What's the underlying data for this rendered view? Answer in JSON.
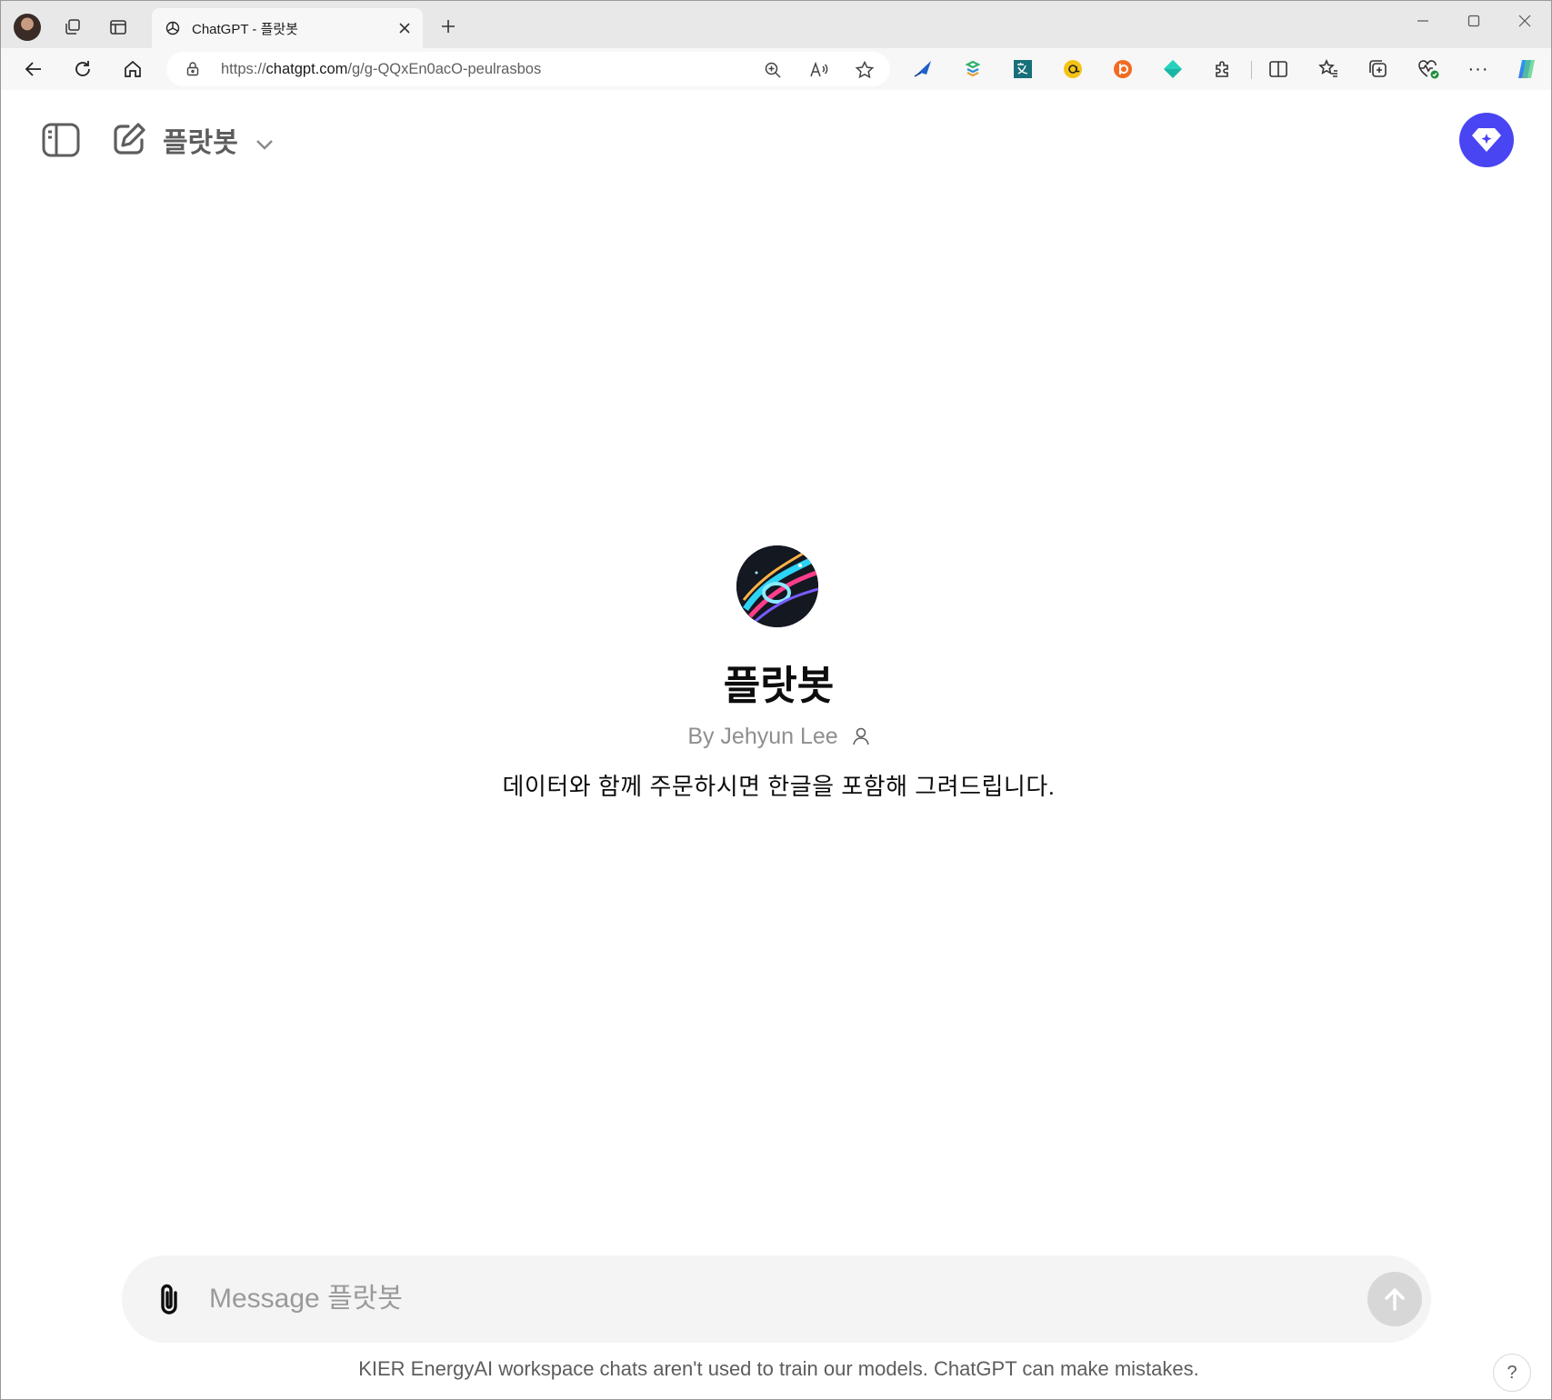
{
  "browser": {
    "tab": {
      "title": "ChatGPT - 플랏봇",
      "close_glyph": "✕"
    },
    "new_tab_glyph": "+",
    "address": {
      "scheme": "https://",
      "host": "chatgpt.com",
      "path": "/g/g-QQxEn0acO-peulrasbos"
    },
    "window_controls": {
      "minimize": "—",
      "maximize": "☐",
      "close": "✕"
    },
    "more_glyph": "···"
  },
  "header": {
    "model_title": "플랏봇"
  },
  "gpt": {
    "name": "플랏봇",
    "author": "By Jehyun Lee",
    "description": "데이터와 함께 주문하시면 한글을 포함해 그려드립니다."
  },
  "composer": {
    "placeholder": "Message 플랏봇",
    "value": ""
  },
  "footer": {
    "disclaimer": "KIER EnergyAI workspace chats aren't used to train our models. ChatGPT can make mistakes.",
    "help_label": "?"
  },
  "colors": {
    "accent": "#4a45f2",
    "composer_bg": "#f4f4f4",
    "send_disabled": "#d7d7d7"
  },
  "icons": [
    "profile-avatar",
    "workspaces-icon",
    "tab-actions-icon",
    "chatgpt-logo-icon",
    "close-icon",
    "plus-icon",
    "back-icon",
    "refresh-icon",
    "home-icon",
    "lock-icon",
    "zoom-icon",
    "read-aloud-icon",
    "favorite-star-icon",
    "sidebar-toggle-icon",
    "new-chat-icon",
    "chevron-down-icon",
    "diamond-sparkle-icon",
    "paperclip-icon",
    "arrow-up-icon",
    "user-icon"
  ]
}
